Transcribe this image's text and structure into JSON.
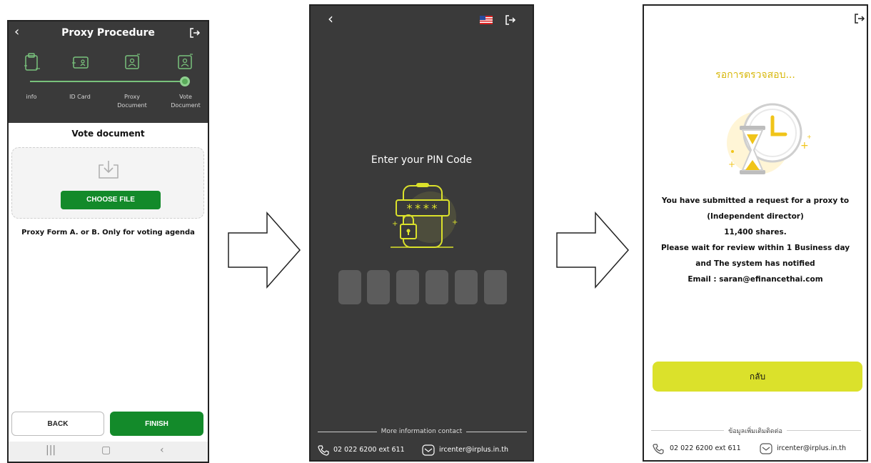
{
  "screen1": {
    "title": "Proxy Procedure",
    "back_icon": "chevron-left-icon",
    "logout_icon": "logout-icon",
    "steps": [
      {
        "label": "info",
        "icon": "form-icon"
      },
      {
        "label": "ID Card",
        "icon": "id-card-icon"
      },
      {
        "label": "Proxy\nDocument",
        "icon": "proxy-doc-icon"
      },
      {
        "label": "Vote\nDocument",
        "icon": "vote-doc-icon"
      }
    ],
    "sheet_title": "Vote document",
    "choose_file": "CHOOSE FILE",
    "note": "Proxy Form A. or B. Only for voting agenda",
    "back_button": "BACK",
    "finish_button": "FINISH",
    "accent": "#138a2a"
  },
  "screen2": {
    "pin_title": "Enter your PIN Code",
    "pin_mask": "****",
    "pin_length": 6,
    "more_info": "More information contact",
    "phone": "02 022 6200 ext 611",
    "email": "ircenter@irplus.in.th",
    "background": "#3a3a3a"
  },
  "screen3": {
    "status": "รอการตรวจสอบ...",
    "message_lines": [
      "You have submitted a request for a proxy to",
      "(Independent director)",
      "11,400 shares.",
      "Please wait for review within 1 Business day",
      "and The system has notified",
      "Email : saran@efinancethai.com"
    ],
    "return_button": "กลับ",
    "more_info": "ข้อมูลเพิ่มเติมติดต่อ",
    "phone": "02 022 6200 ext 611",
    "email": "ircenter@irplus.in.th",
    "accent": "#dbe12b"
  }
}
